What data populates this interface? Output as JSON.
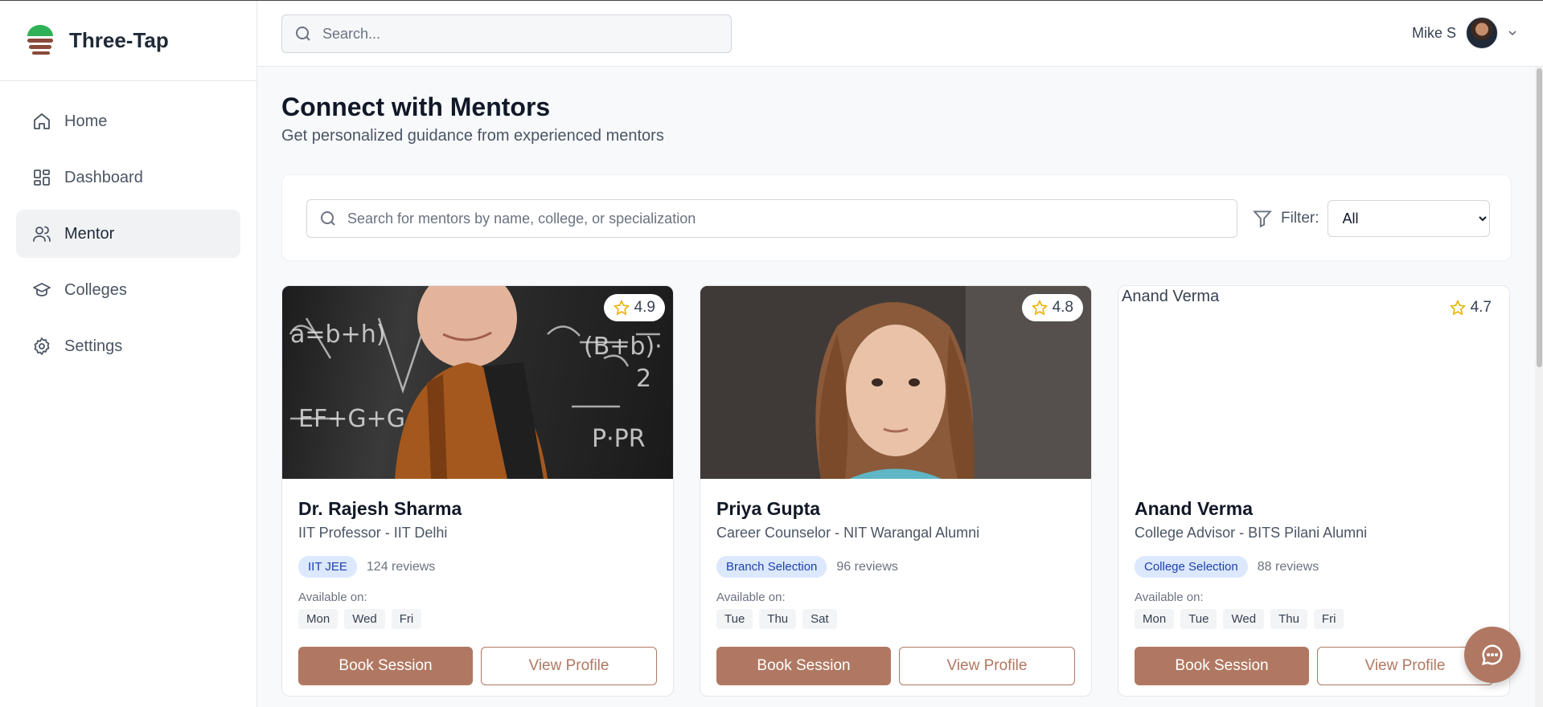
{
  "brand": {
    "name": "Three-Tap",
    "logo_icon": "stacked-bars-logo"
  },
  "sidebar": {
    "items": [
      {
        "label": "Home",
        "icon": "home-icon"
      },
      {
        "label": "Dashboard",
        "icon": "dashboard-icon"
      },
      {
        "label": "Mentor",
        "icon": "users-icon",
        "active": true
      },
      {
        "label": "Colleges",
        "icon": "graduation-cap-icon"
      },
      {
        "label": "Settings",
        "icon": "gear-icon"
      }
    ]
  },
  "header": {
    "search_placeholder": "Search...",
    "user_name": "Mike S"
  },
  "main": {
    "title": "Connect with Mentors",
    "subtitle": "Get personalized guidance from experienced mentors",
    "mentor_search_placeholder": "Search for mentors by name, college, or specialization",
    "filter_label": "Filter:",
    "filter_selected": "All"
  },
  "mentors": [
    {
      "name": "Dr. Rajesh Sharma",
      "role": "IIT Professor - IIT Delhi",
      "rating": "4.9",
      "tag": "IIT JEE",
      "reviews": "124 reviews",
      "available_label": "Available on:",
      "days": [
        "Mon",
        "Wed",
        "Fri"
      ],
      "book_label": "Book Session",
      "view_label": "View Profile"
    },
    {
      "name": "Priya Gupta",
      "role": "Career Counselor - NIT Warangal Alumni",
      "rating": "4.8",
      "tag": "Branch Selection",
      "reviews": "96 reviews",
      "available_label": "Available on:",
      "days": [
        "Tue",
        "Thu",
        "Sat"
      ],
      "book_label": "Book Session",
      "view_label": "View Profile"
    },
    {
      "name": "Anand Verma",
      "role": "College Advisor - BITS Pilani Alumni",
      "rating": "4.7",
      "photo_alt": "Anand Verma",
      "tag": "College Selection",
      "reviews": "88 reviews",
      "available_label": "Available on:",
      "days": [
        "Mon",
        "Tue",
        "Wed",
        "Thu",
        "Fri"
      ],
      "book_label": "Book Session",
      "view_label": "View Profile"
    }
  ],
  "colors": {
    "accent": "#b07862",
    "tag_bg": "#dbe8fd",
    "tag_text": "#1e40af",
    "star": "#eab308"
  }
}
